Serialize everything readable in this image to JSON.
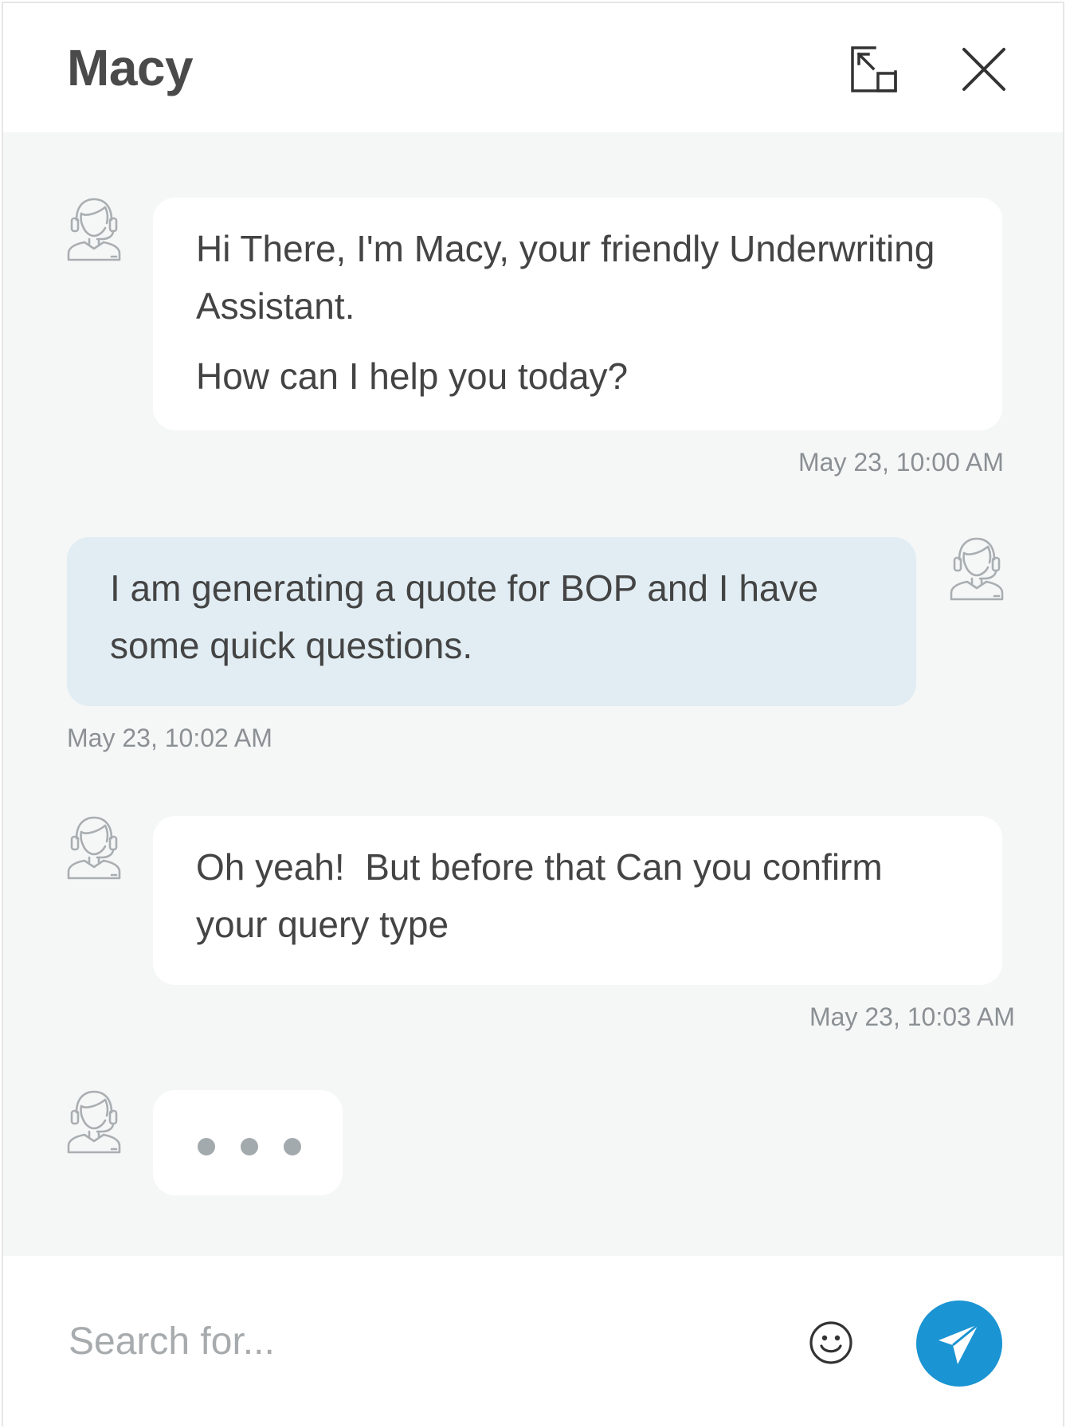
{
  "header": {
    "title": "Macy",
    "expand_icon": "expand-icon",
    "close_icon": "close-icon"
  },
  "messages": [
    {
      "sender": "bot",
      "avatar_icon": "support-agent-icon",
      "paragraphs": [
        "Hi There, I'm Macy, your friendly Underwriting Assistant.",
        "How can I help you today?"
      ],
      "lines": [
        "Hi There, I'm Macy, your friendly Underwriting",
        "Assistant.",
        "How can I help you today?"
      ],
      "timestamp": "May 23, 10:00 AM"
    },
    {
      "sender": "user",
      "avatar_icon": "support-agent-icon",
      "lines": [
        "I am generating a quote for BOP and I have",
        "some quick questions."
      ],
      "timestamp": "May 23, 10:02 AM"
    },
    {
      "sender": "bot",
      "avatar_icon": "support-agent-icon",
      "lines": [
        "Oh yeah!  But before that Can you confirm",
        "your query type"
      ],
      "timestamp": "May 23, 10:03 AM"
    }
  ],
  "typing_indicator": {
    "avatar_icon": "support-agent-icon",
    "dot_count": 3
  },
  "composer": {
    "placeholder": "Search for...",
    "value": "",
    "emoji_icon": "smiley-icon",
    "send_icon": "paper-plane-icon"
  },
  "colors": {
    "chat_background": "#f5f7f7",
    "bot_bubble": "#ffffff",
    "user_bubble": "#e1edf3",
    "send_button": "#1a94d2",
    "timestamp_text": "#8b9094"
  }
}
